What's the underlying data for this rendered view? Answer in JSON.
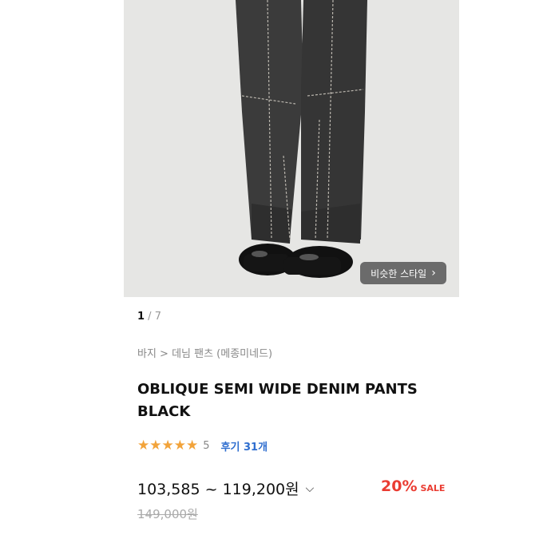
{
  "gallery": {
    "similar_style_label": "비슷한 스타일",
    "counter_current": "1",
    "counter_sep": " / ",
    "counter_total": "7"
  },
  "breadcrumb": "바지 > 데님 팬츠 (메종미네드)",
  "product": {
    "title": "OBLIQUE SEMI WIDE DENIM PANTS BLACK",
    "rating_stars": 5,
    "rating_score": "5",
    "reviews_label": "후기 31개",
    "price_range": "103,585 ~ 119,200원",
    "discount_pct": "20%",
    "sale_label": "SALE",
    "original_price": "149,000원"
  },
  "colors": {
    "star": "#f2a33a",
    "discount": "#ea3c32",
    "review_link": "#2f6ecf"
  },
  "icons": [
    "chevron-right-icon",
    "chevron-down-icon",
    "star-icon"
  ]
}
